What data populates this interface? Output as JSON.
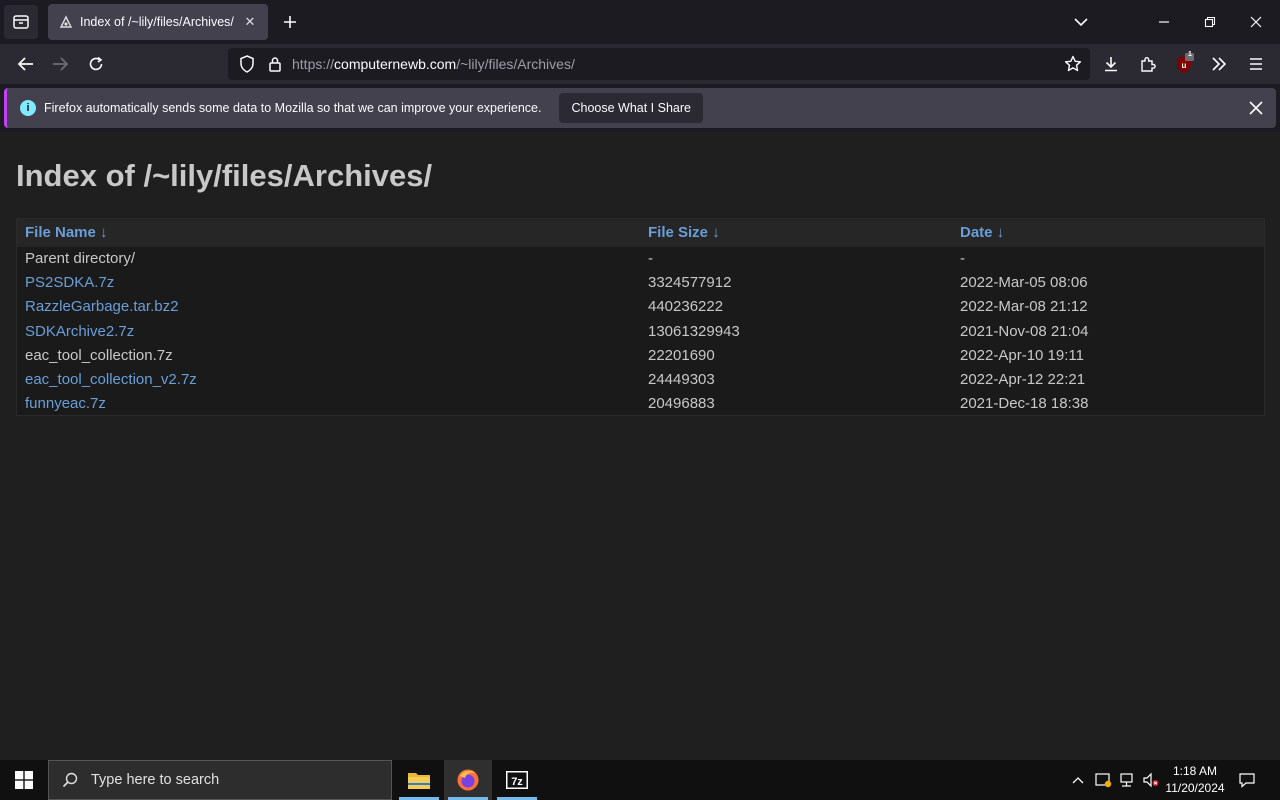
{
  "browser": {
    "tab_title": "Index of /~lily/files/Archives/",
    "url_scheme": "https://",
    "url_host": "computernewb.com",
    "url_path": "/~lily/files/Archives/",
    "extension_badge": "1"
  },
  "notification": {
    "message": "Firefox automatically sends some data to Mozilla so that we can improve your experience.",
    "button_label": "Choose What I Share"
  },
  "page": {
    "heading": "Index of /~lily/files/Archives/",
    "columns": [
      "File Name  ↓",
      "File Size  ↓",
      "Date  ↓"
    ],
    "rows": [
      {
        "name": "Parent directory/",
        "size": "-",
        "date": "-"
      },
      {
        "name": "PS2SDKA.7z",
        "size": "3324577912",
        "date": "2022-Mar-05 08:06"
      },
      {
        "name": "RazzleGarbage.tar.bz2",
        "size": "440236222",
        "date": "2022-Mar-08 21:12"
      },
      {
        "name": "SDKArchive2.7z",
        "size": "13061329943",
        "date": "2021-Nov-08 21:04"
      },
      {
        "name": "eac_tool_collection.7z",
        "size": "22201690",
        "date": "2022-Apr-10 19:11"
      },
      {
        "name": "eac_tool_collection_v2.7z",
        "size": "24449303",
        "date": "2022-Apr-12 22:21"
      },
      {
        "name": "funnyeac.7z",
        "size": "20496883",
        "date": "2021-Dec-18 18:38"
      }
    ]
  },
  "taskbar": {
    "search_placeholder": "Type here to search",
    "time": "1:18 AM",
    "date": "11/20/2024"
  },
  "colors": {
    "link": "#6a9ed8",
    "accent": "#c33ff5",
    "info": "#80ebff"
  }
}
